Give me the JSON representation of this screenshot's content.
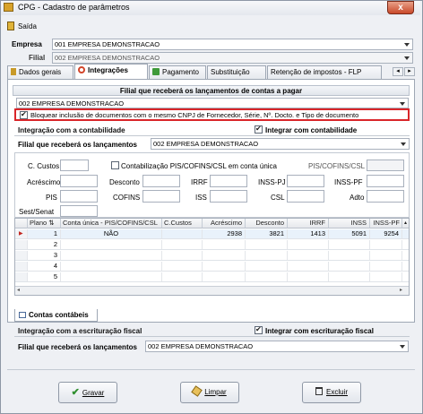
{
  "window": {
    "title": "CPG - Cadastro de parâmetros",
    "close_glyph": "x"
  },
  "menu": {
    "exit_label": "Saída"
  },
  "empresa": {
    "label": "Empresa",
    "value": "001 EMPRESA DEMONSTRACAO"
  },
  "filial": {
    "label": "Filial",
    "value": "002 EMPRESA DEMONSTRACAO"
  },
  "tabs": [
    {
      "label": "Dados gerais",
      "icon": "tag-icon"
    },
    {
      "label": "Integrações",
      "icon": "integration-icon"
    },
    {
      "label": "Pagamento",
      "icon": "payment-icon"
    },
    {
      "label": "Substituição"
    },
    {
      "label": "Retenção de impostos - FLP"
    }
  ],
  "filial_pagar": {
    "header": "Filial que receberá os lançamentos de contas a pagar",
    "value": "002 EMPRESA DEMONSTRACAO",
    "block_label": "Bloquear inclusão de documentos com o mesmo CNPJ de Fornecedor, Série, Nº. Docto. e Tipo de documento"
  },
  "contabilidade": {
    "section": "Integração com a contabilidade",
    "integrar_label": "Integrar com contabilidade",
    "filial_label": "Filial que receberá os lançamentos",
    "filial_value": "002 EMPRESA DEMONSTRACAO"
  },
  "form": {
    "c_custos": "C. Custos",
    "contabilizacao": "Contabilização PIS/COFINS/CSL em conta única",
    "pis_cofins_csl": "PIS/COFINS/CSL",
    "acrescimo": "Acréscimo",
    "desconto": "Desconto",
    "irrf": "IRRF",
    "inss_pj": "INSS-PJ",
    "inss_pf": "INSS-PF",
    "pis": "PIS",
    "cofins": "COFINS",
    "iss": "ISS",
    "csl": "CSL",
    "adto": "Adto",
    "sest_senat": "Sest/Senat"
  },
  "grid": {
    "columns": [
      "Plano",
      "Conta única - PIS/COFINS/CSL",
      "C.Custos",
      "Acréscimo",
      "Desconto",
      "IRRF",
      "INSS",
      "INSS-PF"
    ],
    "rows": [
      {
        "n": "1",
        "conta": "NÃO",
        "ccustos": "",
        "acrescimo": "2938",
        "desconto": "3821",
        "irrf": "1413",
        "inss": "5091",
        "inss_pf": "9254"
      },
      {
        "n": "2",
        "conta": "",
        "ccustos": "",
        "acrescimo": "",
        "desconto": "",
        "irrf": "",
        "inss": "",
        "inss_pf": ""
      },
      {
        "n": "3",
        "conta": "",
        "ccustos": "",
        "acrescimo": "",
        "desconto": "",
        "irrf": "",
        "inss": "",
        "inss_pf": ""
      },
      {
        "n": "4",
        "conta": "",
        "ccustos": "",
        "acrescimo": "",
        "desconto": "",
        "irrf": "",
        "inss": "",
        "inss_pf": ""
      },
      {
        "n": "5",
        "conta": "",
        "ccustos": "",
        "acrescimo": "",
        "desconto": "",
        "irrf": "",
        "inss": "",
        "inss_pf": ""
      }
    ]
  },
  "contas_tab": {
    "label": "Contas contábeis"
  },
  "escrituracao": {
    "section": "Integração com a escrituração fiscal",
    "integrar_label": "Integrar com escrituração fiscal",
    "filial_label": "Filial que receberá os lançamentos",
    "filial_value": "002 EMPRESA DEMONSTRACAO"
  },
  "buttons": {
    "gravar": "Gravar",
    "limpar": "Limpar",
    "excluir": "Excluir"
  },
  "colors": {
    "highlight_red": "#d9262a",
    "accent_green": "#2f8f2f"
  }
}
